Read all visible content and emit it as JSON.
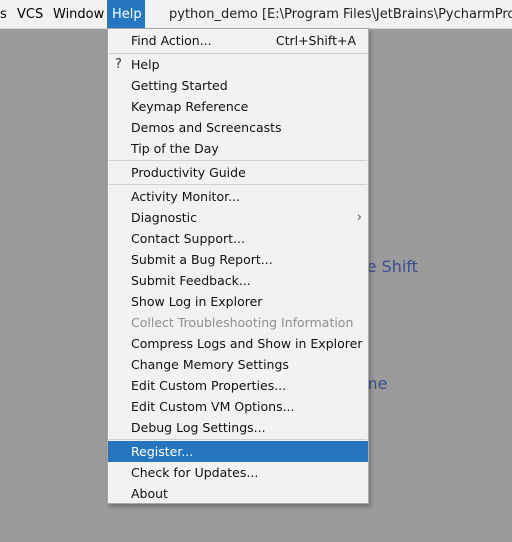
{
  "menubar": {
    "items": [
      "s",
      "VCS",
      "Window",
      "Help"
    ],
    "title": "python_demo [E:\\Program Files\\JetBrains\\PycharmProjects\\"
  },
  "background_hints": [
    "ble Shift",
    "me"
  ],
  "help_menu": {
    "find_action": {
      "label": "Find Action...",
      "shortcut": "Ctrl+Shift+A"
    },
    "group1": [
      "Help",
      "Getting Started",
      "Keymap Reference",
      "Demos and Screencasts",
      "Tip of the Day"
    ],
    "group2": [
      "Productivity Guide"
    ],
    "group3": [
      "Activity Monitor...",
      "Diagnostic",
      "Contact Support...",
      "Submit a Bug Report...",
      "Submit Feedback...",
      "Show Log in Explorer",
      "Collect Troubleshooting Information",
      "Compress Logs and Show in Explorer",
      "Change Memory Settings",
      "Edit Custom Properties...",
      "Edit Custom VM Options...",
      "Debug Log Settings..."
    ],
    "group4": [
      "Register...",
      "Check for Updates...",
      "About"
    ],
    "help_icon": "?",
    "submenu_arrow": "›"
  },
  "colors": {
    "selection": "#2675bf",
    "hint_text": "#3b4d8f"
  }
}
